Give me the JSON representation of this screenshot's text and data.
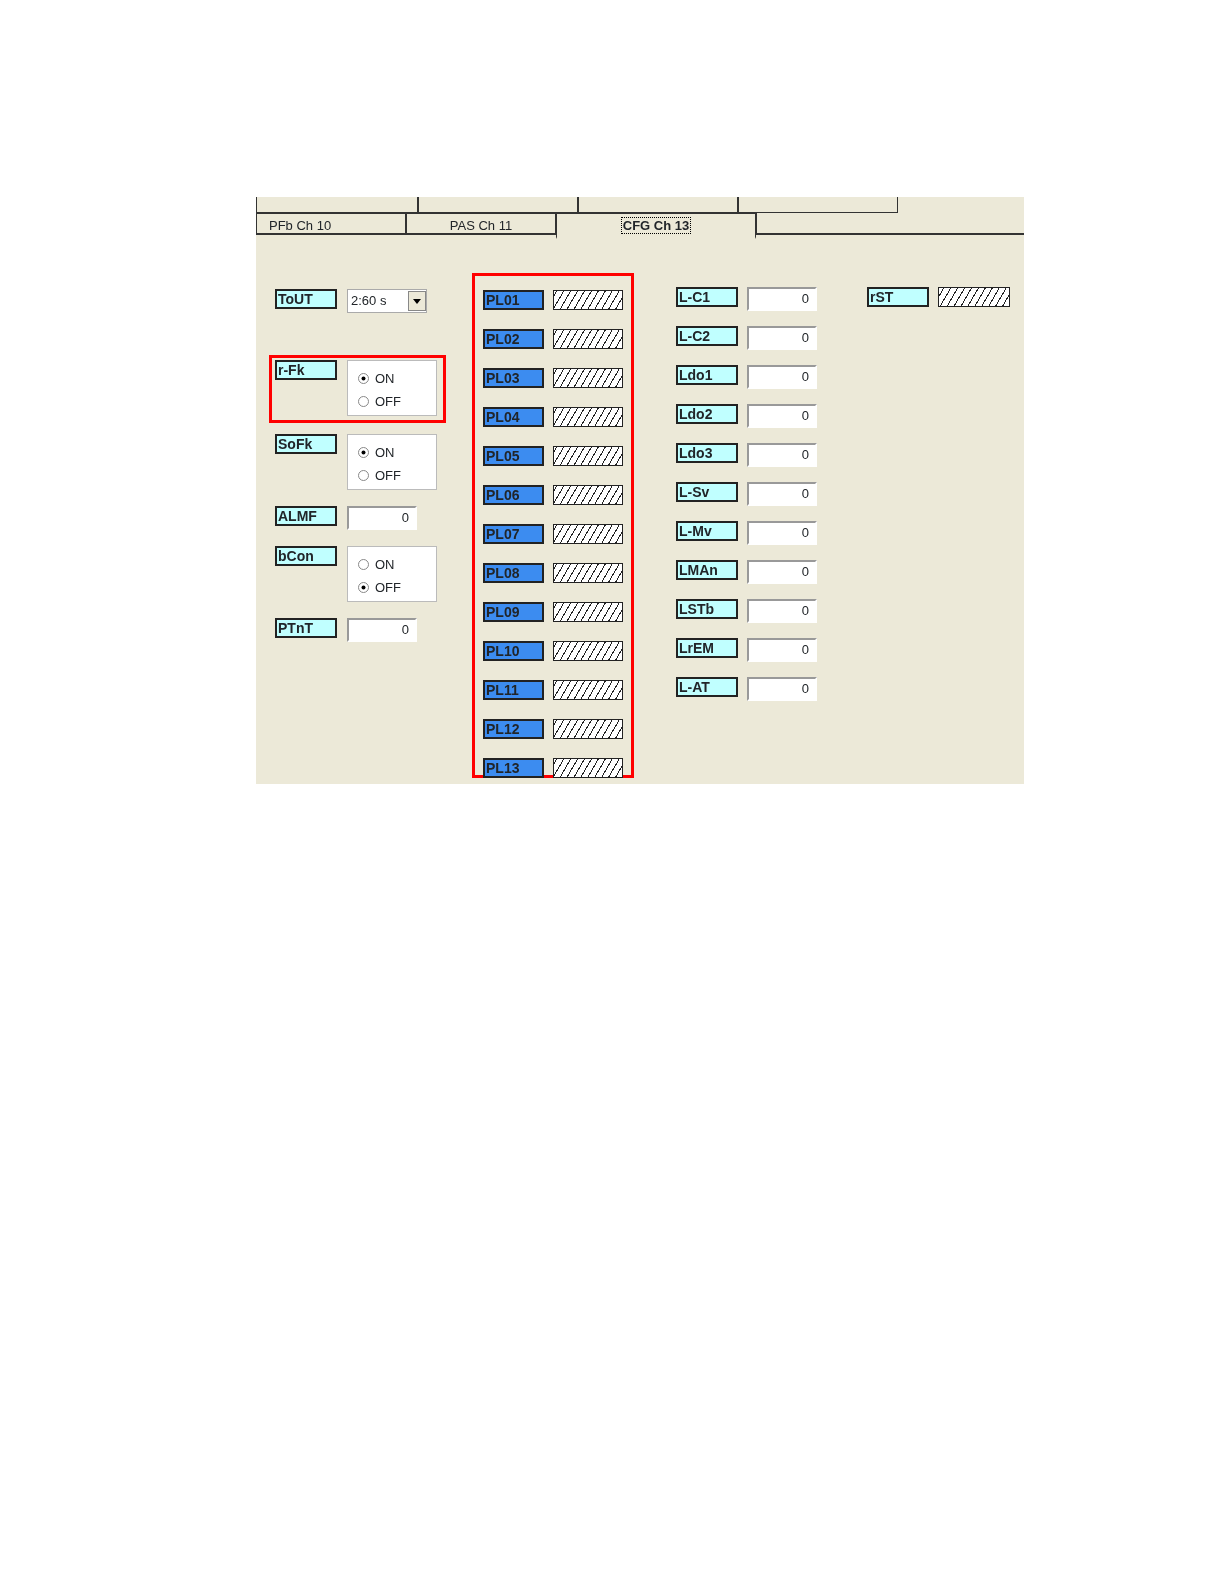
{
  "tabs": [
    {
      "label": "PFb Ch 10",
      "selected": false
    },
    {
      "label": "PAS Ch 11",
      "selected": false
    },
    {
      "label": "CFG Ch 13",
      "selected": true
    }
  ],
  "left_params": [
    {
      "kind": "dropdown",
      "label": "ToUT",
      "value": "2:60 s"
    },
    {
      "kind": "radio",
      "label": "r-Fk",
      "highlighted": true,
      "options": [
        {
          "label": "ON",
          "selected": true
        },
        {
          "label": "OFF",
          "selected": false
        }
      ]
    },
    {
      "kind": "radio",
      "label": "SoFk",
      "highlighted": false,
      "options": [
        {
          "label": "ON",
          "selected": true
        },
        {
          "label": "OFF",
          "selected": false
        }
      ]
    },
    {
      "kind": "number",
      "label": "ALMF",
      "value": "0"
    },
    {
      "kind": "radio",
      "label": "bCon",
      "highlighted": false,
      "options": [
        {
          "label": "ON",
          "selected": false
        },
        {
          "label": "OFF",
          "selected": true
        }
      ]
    },
    {
      "kind": "number",
      "label": "PTnT",
      "value": "0"
    }
  ],
  "pl_group": {
    "highlighted": true,
    "items": [
      {
        "label": "PL01",
        "kind": "hatched"
      },
      {
        "label": "PL02",
        "kind": "hatched"
      },
      {
        "label": "PL03",
        "kind": "hatched"
      },
      {
        "label": "PL04",
        "kind": "hatched"
      },
      {
        "label": "PL05",
        "kind": "hatched"
      },
      {
        "label": "PL06",
        "kind": "hatched"
      },
      {
        "label": "PL07",
        "kind": "hatched"
      },
      {
        "label": "PL08",
        "kind": "hatched"
      },
      {
        "label": "PL09",
        "kind": "hatched"
      },
      {
        "label": "PL10",
        "kind": "hatched"
      },
      {
        "label": "PL11",
        "kind": "hatched"
      },
      {
        "label": "PL12",
        "kind": "hatched"
      },
      {
        "label": "PL13",
        "kind": "hatched"
      }
    ]
  },
  "l_params": [
    {
      "label": "L-C1",
      "kind": "number",
      "value": "0"
    },
    {
      "label": "L-C2",
      "kind": "number",
      "value": "0"
    },
    {
      "label": "Ldo1",
      "kind": "number",
      "value": "0"
    },
    {
      "label": "Ldo2",
      "kind": "number",
      "value": "0"
    },
    {
      "label": "Ldo3",
      "kind": "number",
      "value": "0"
    },
    {
      "label": "L-Sv",
      "kind": "number",
      "value": "0"
    },
    {
      "label": "L-Mv",
      "kind": "number",
      "value": "0"
    },
    {
      "label": "LMAn",
      "kind": "number",
      "value": "0"
    },
    {
      "label": "LSTb",
      "kind": "number",
      "value": "0"
    },
    {
      "label": "LrEM",
      "kind": "number",
      "value": "0"
    },
    {
      "label": "L-AT",
      "kind": "number",
      "value": "0"
    }
  ],
  "r_params": [
    {
      "label": "rST",
      "kind": "hatched"
    }
  ]
}
